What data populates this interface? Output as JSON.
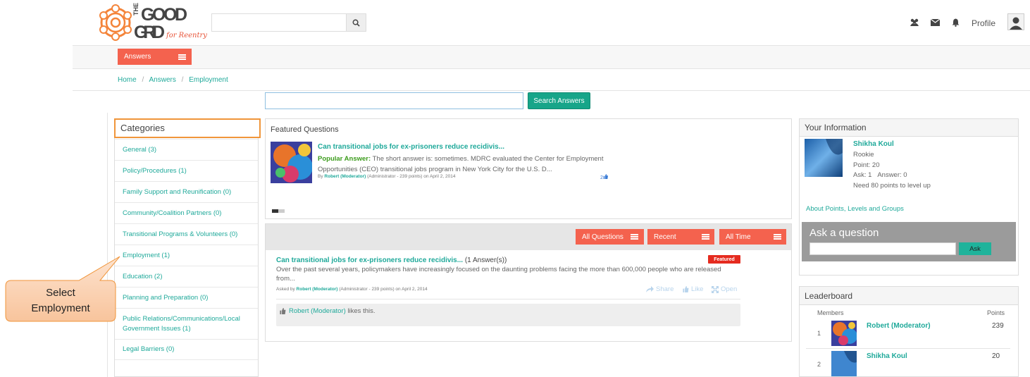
{
  "colors": {
    "accent": "#f4624e",
    "teal": "#1fa99a",
    "green_button": "#17a589",
    "badge_red": "#e52b1f",
    "callout": "#fbd3b4"
  },
  "header": {
    "logo": {
      "line1": "THE",
      "line2": "GOOD",
      "line3": "GRID",
      "tagline": "for Reentry"
    },
    "search": {
      "placeholder": "",
      "icon": "search-icon"
    },
    "icons": [
      "users-icon",
      "envelope-icon",
      "bell-icon"
    ],
    "profile_label": "Profile"
  },
  "nav": {
    "answers_tab": "Answers",
    "breadcrumb": [
      "Home",
      "/",
      "Answers",
      "/",
      "Employment"
    ],
    "search_button": "Search Answers"
  },
  "categories": {
    "title": "Categories",
    "items": [
      "General (3)",
      "Policy/Procedures (1)",
      "Family Support and Reunification (0)",
      "Community/Coalition Partners (0)",
      "Transitional Programs & Volunteers (0)",
      "Employment (1)",
      "Education (2)",
      "Planning and Preparation (0)",
      "Public Relations/Communications/Local Government Issues (1)",
      "Legal Barriers (0)"
    ]
  },
  "callout": {
    "line1": "Select",
    "line2": "Employment"
  },
  "featured": {
    "title": "Featured Questions",
    "question": "Can transitional jobs for ex-prisoners reduce recidivis...",
    "answer_label": "Popular Answer:",
    "answer_text": " The short answer is: sometimes. MDRC evaluated the Center for Employment Opportunities (CEO) transitional jobs program in New York City for the U.S. D...",
    "by_prefix": "By ",
    "by_name": "Robert (Moderator)",
    "by_meta": " (Administrator - 239 points)  on April 2, 2014",
    "likes": "2"
  },
  "question_list": {
    "filters": [
      "All Questions",
      "Recent",
      "All Time"
    ],
    "question_title": "Can transitional jobs for ex-prisoners reduce recidivis...",
    "answer_count": " (1 Answer(s))",
    "badge": "Featured",
    "body": "Over the past several years, policymakers have increasingly focused on the daunting problems facing the more than 600,000 people who are released from...",
    "asked_prefix": "Asked by ",
    "asked_name": "Robert (Moderator)",
    "asked_meta": " (Administrator - 239 points)  on April 2, 2014",
    "actions": [
      "Share",
      "Like",
      "Open"
    ],
    "liker": "Robert (Moderator)",
    "likes_suffix": " likes this."
  },
  "your_info": {
    "title": "Your Information",
    "name": "Shikha Koul",
    "level": "Rookie",
    "points": "Point: 20",
    "ask": "Ask: 1",
    "answer": "Answer: 0",
    "level_up": "Need 80 points to level up",
    "link": "About Points, Levels and Groups"
  },
  "ask_question": {
    "title": "Ask a question",
    "button": "Ask"
  },
  "leaderboard": {
    "title": "Leaderboard",
    "members_label": "Members",
    "points_label": "Points",
    "rows": [
      {
        "rank": "1",
        "name": "Robert (Moderator)",
        "points": "239"
      },
      {
        "rank": "2",
        "name": "Shikha Koul",
        "points": "20"
      }
    ]
  }
}
